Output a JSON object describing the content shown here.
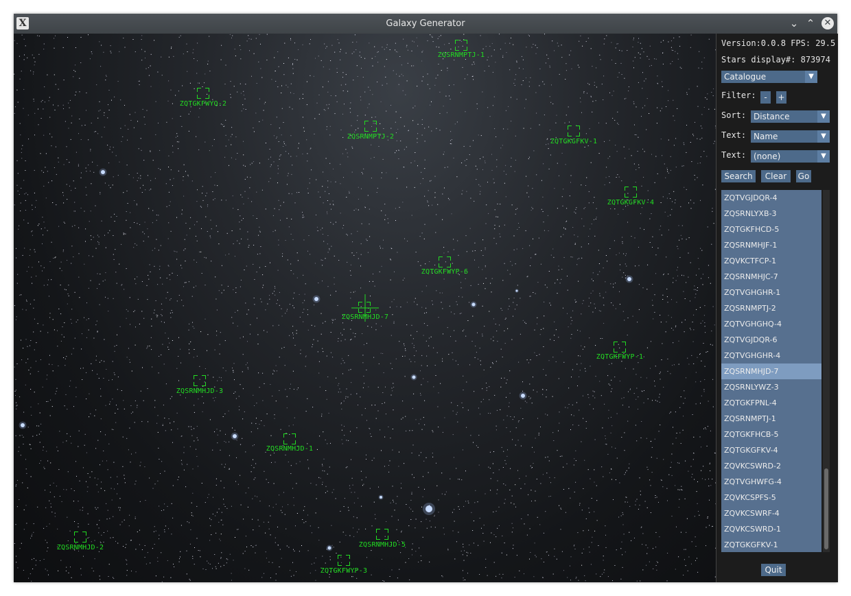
{
  "window": {
    "title": "Galaxy Generator",
    "app_icon_glyph": "X",
    "minimize_glyph": "⌄",
    "maximize_glyph": "⌃",
    "close_glyph": "✕"
  },
  "panel": {
    "version_text": "Version:0.0.8 FPS: 29.5",
    "stars_text": "Stars display#:  873974",
    "mode_select": "Catalogue",
    "filter_label": "Filter:",
    "filter_minus": "-",
    "filter_plus": "+",
    "sort_label": "Sort:",
    "sort_value": "Distance",
    "text1_label": "Text:",
    "text1_value": "Name",
    "text2_label": "Text:",
    "text2_value": "(none)",
    "search_button": "Search",
    "clear_button": "Clear",
    "go_button": "Go",
    "quit_button": "Quit",
    "list_items": [
      "ZQTVGJDQR-4",
      "ZQSRNLYXB-3",
      "ZQTGKFHCD-5",
      "ZQSRNMHJF-1",
      "ZQVKCTFCP-1",
      "ZQSRNMHJC-7",
      "ZQTVGHGHR-1",
      "ZQSRNMPTJ-2",
      "ZQTVGHGHQ-4",
      "ZQTVGJDQR-6",
      "ZQTVGHGHR-4",
      "ZQSRNMHJD-7",
      "ZQSRNLYWZ-3",
      "ZQTGKFPNL-4",
      "ZQSRNMPTJ-1",
      "ZQTGKFHCB-5",
      "ZQTGKGFKV-4",
      "ZQVKCSWRD-2",
      "ZQTVGHWFG-4",
      "ZQVKCSPFS-5",
      "ZQVKCSWRF-4",
      "ZQVKCSWRD-1",
      "ZQTGKGFKV-1"
    ],
    "selected_item": "ZQSRNMHJD-7"
  },
  "markers": [
    "ZQSRNMPTJ-1",
    "ZQTGKFWYQ-2",
    "ZQSRNMPTJ-2",
    "ZQTGKGFKV-1",
    "ZQTGKGFKV-4",
    "ZQTGKFWYP-6",
    "ZQSRNMHJD-7",
    "ZQTGKFWYP-1",
    "ZQSRNMHJD-3",
    "ZQSRNMHJD-1",
    "ZQSRNMHJD-2",
    "ZQSRNMHJD-5",
    "ZQTGKFWYP-3"
  ],
  "colors": {
    "marker": "#22dd22",
    "panel_widget": "#4d6a8a",
    "list_bg": "#57708f",
    "list_selected": "#7e9cc0"
  }
}
